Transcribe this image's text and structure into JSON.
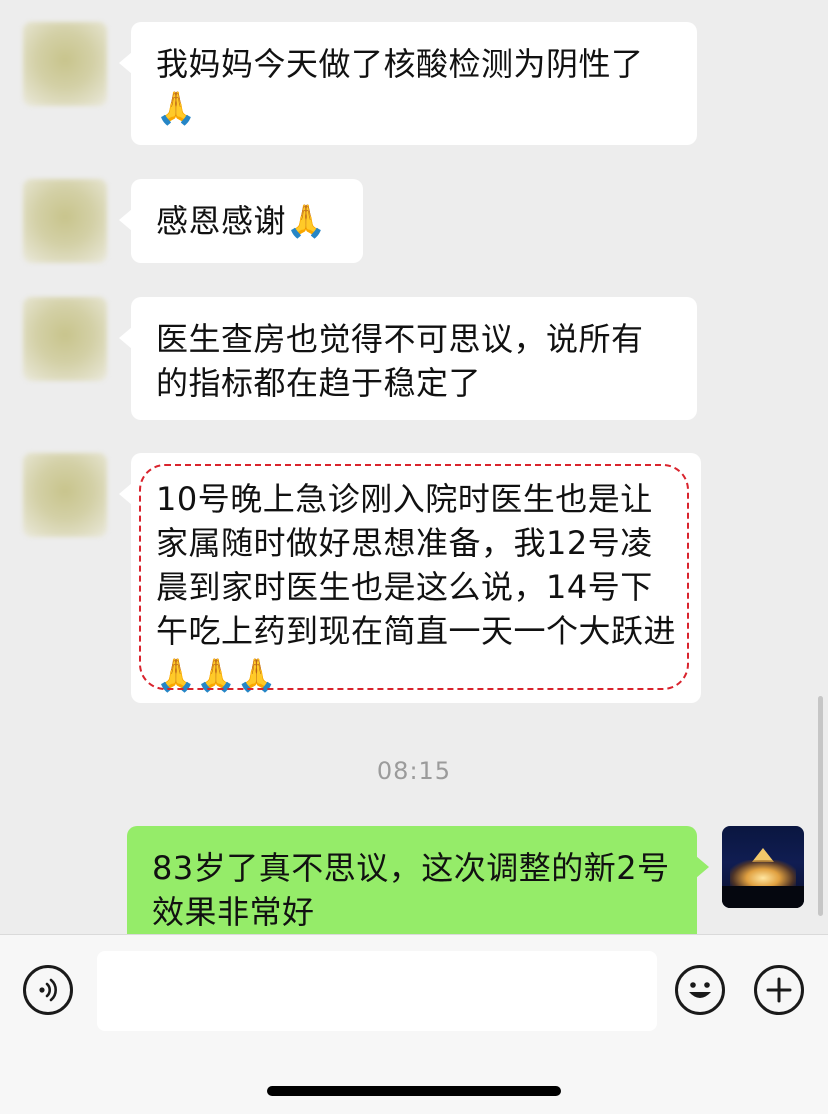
{
  "messages": [
    {
      "from": "other",
      "text": "我妈妈今天做了核酸检测为阴性了🙏"
    },
    {
      "from": "other",
      "text": "感恩感谢🙏"
    },
    {
      "from": "other",
      "text": "医生查房也觉得不可思议，说所有的指标都在趋于稳定了"
    },
    {
      "from": "other",
      "text": "10号晚上急诊刚入院时医生也是让家属随时做好思想准备，我12号凌晨到家时医生也是这么说，14号下午吃上药到现在简直一天一个大跃进🙏🙏🙏",
      "highlighted": true
    },
    {
      "from": "me",
      "text": "83岁了真不思议，这次调整的新2号效果非常好"
    }
  ],
  "timestamp": "08:15",
  "input_bar": {
    "voice_icon": "voice-icon",
    "emoji_icon": "emoji-icon",
    "plus_icon": "plus-icon",
    "input_value": ""
  },
  "colors": {
    "background": "#ededed",
    "incoming_bubble": "#ffffff",
    "outgoing_bubble": "#95ec69",
    "highlight": "#d9232d"
  }
}
